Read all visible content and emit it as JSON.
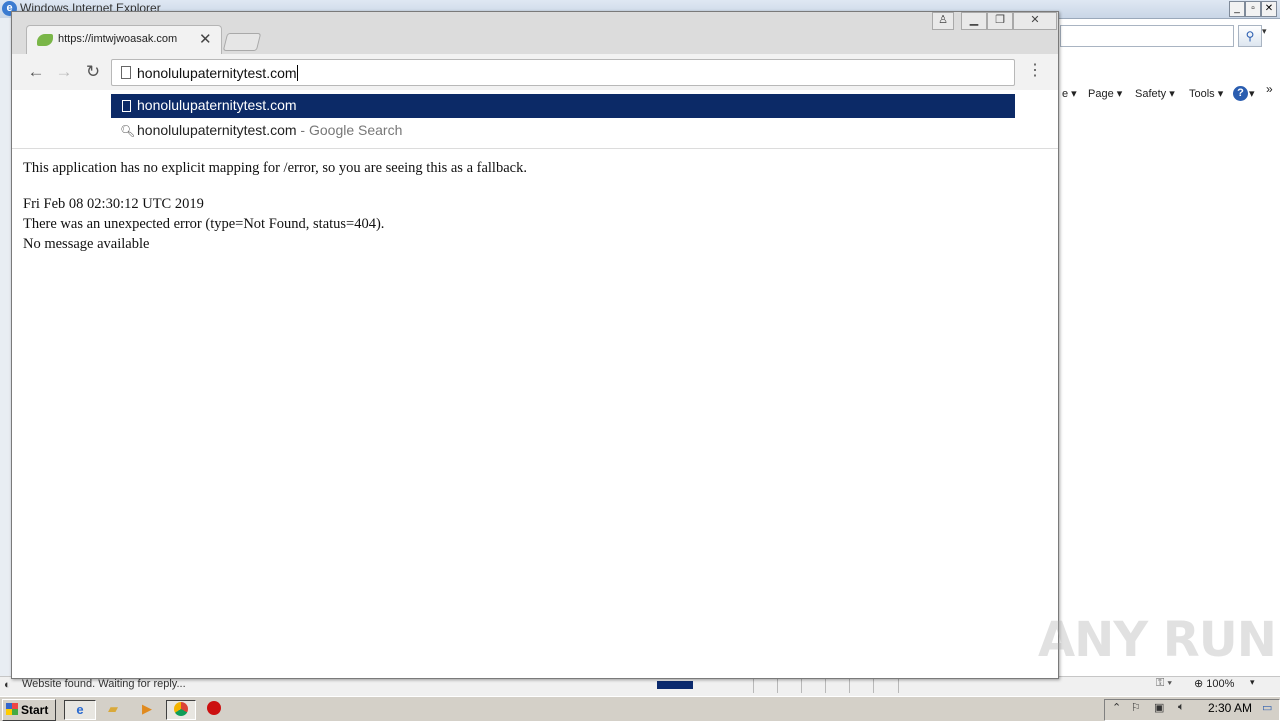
{
  "ie": {
    "title": "Windows Internet Explorer",
    "command_bar": {
      "page_label": "Page",
      "safety_label": "Safety",
      "tools_label": "Tools",
      "partial_label": "e"
    },
    "status_text": "Website found. Waiting for reply...",
    "zoom_label": "100%"
  },
  "chrome": {
    "tab": {
      "title": "https://imtwjwoasak.com",
      "close_glyph": "✕"
    },
    "omnibox": {
      "value": "honolulupaternitytest.com"
    },
    "suggestions": [
      {
        "text": "honolulupaternitytest.com",
        "hint": ""
      },
      {
        "text": "honolulupaternitytest.com",
        "hint": " - Google Search"
      }
    ],
    "page": {
      "lines": [
        "This application has no explicit mapping for /error, so you are seeing this as a fallback.",
        "Fri Feb 08 02:30:12 UTC 2019",
        "There was an unexpected error (type=Not Found, status=404).",
        "No message available"
      ]
    }
  },
  "taskbar": {
    "start_label": "Start",
    "clock": "2:30 AM"
  },
  "watermark": "ANY RUN"
}
